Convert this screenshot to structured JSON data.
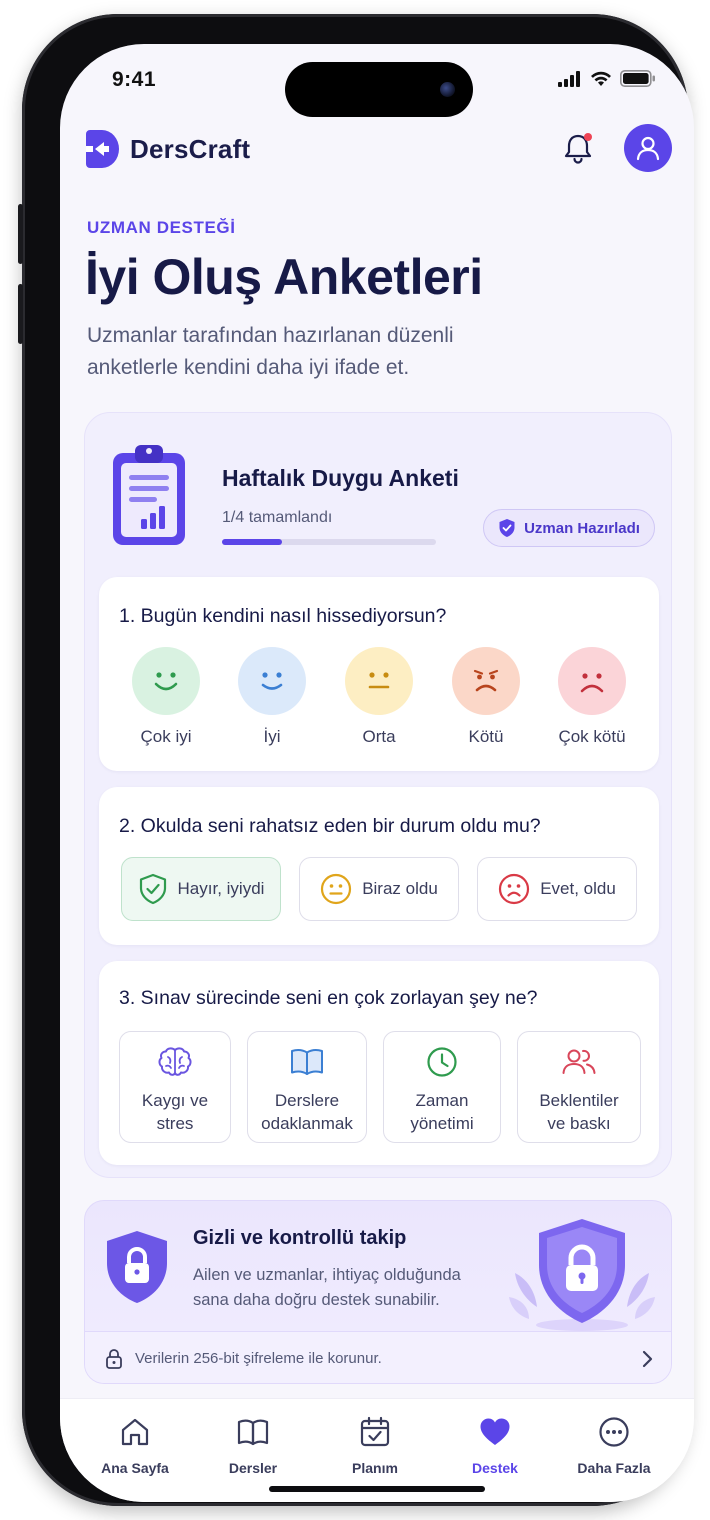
{
  "status": {
    "time": "9:41"
  },
  "app": {
    "name": "DersCraft"
  },
  "page": {
    "eyebrow": "UZMAN DESTEĞİ",
    "title": "İyi Oluş Anketleri",
    "subtitle": "Uzmanlar tarafından hazırlanan düzenli anketlerle kendini daha iyi ifade et."
  },
  "survey": {
    "title": "Haftalık Duygu Anketi",
    "progress_text": "1/4 tamamlandı",
    "progress_fraction": 0.28,
    "badge": "Uzman Hazırladı",
    "questions": [
      {
        "title": "1. Bugün kendini nasıl hissediyorsun?",
        "options": [
          {
            "label": "Çok iyi",
            "icon": "very-happy-face-icon",
            "color": "#34a853"
          },
          {
            "label": "İyi",
            "icon": "happy-face-icon",
            "color": "#3b82d6"
          },
          {
            "label": "Orta",
            "icon": "neutral-face-icon",
            "color": "#e0a51b"
          },
          {
            "label": "Kötü",
            "icon": "sad-face-icon",
            "color": "#d9552f"
          },
          {
            "label": "Çok kötü",
            "icon": "very-sad-face-icon",
            "color": "#d93a46"
          }
        ]
      },
      {
        "title": "2. Okulda seni rahatsız eden bir durum oldu mu?",
        "options": [
          {
            "label": "Hayır, iyiydi",
            "icon": "shield-check-icon",
            "selected": true
          },
          {
            "label": "Biraz oldu",
            "icon": "neutral-face-icon"
          },
          {
            "label": "Evet, oldu",
            "icon": "sad-face-icon"
          }
        ]
      },
      {
        "title": "3. Sınav sürecinde seni en çok zorlayan şey ne?",
        "options": [
          {
            "line1": "Kaygı ve",
            "line2": "stres",
            "icon": "brain-icon"
          },
          {
            "line1": "Derslere",
            "line2": "odaklanmak",
            "icon": "book-icon"
          },
          {
            "line1": "Zaman",
            "line2": "yönetimi",
            "icon": "clock-icon"
          },
          {
            "line1": "Beklentiler",
            "line2": "ve baskı",
            "icon": "people-icon"
          }
        ]
      }
    ]
  },
  "privacy": {
    "title": "Gizli ve kontrollü takip",
    "body": "Ailen ve uzmanlar, ihtiyaç olduğunda sana daha doğru destek sunabilir.",
    "footer": "Verilerin 256-bit şifreleme ile korunur."
  },
  "tabs": [
    {
      "label": "Ana Sayfa",
      "icon": "home-icon"
    },
    {
      "label": "Dersler",
      "icon": "book-icon"
    },
    {
      "label": "Planım",
      "icon": "calendar-check-icon"
    },
    {
      "label": "Destek",
      "icon": "heart-icon",
      "active": true
    },
    {
      "label": "Daha Fazla",
      "icon": "more-icon"
    }
  ],
  "colors": {
    "accent": "#5b45e8",
    "text": "#171a47",
    "muted": "#555a78"
  }
}
